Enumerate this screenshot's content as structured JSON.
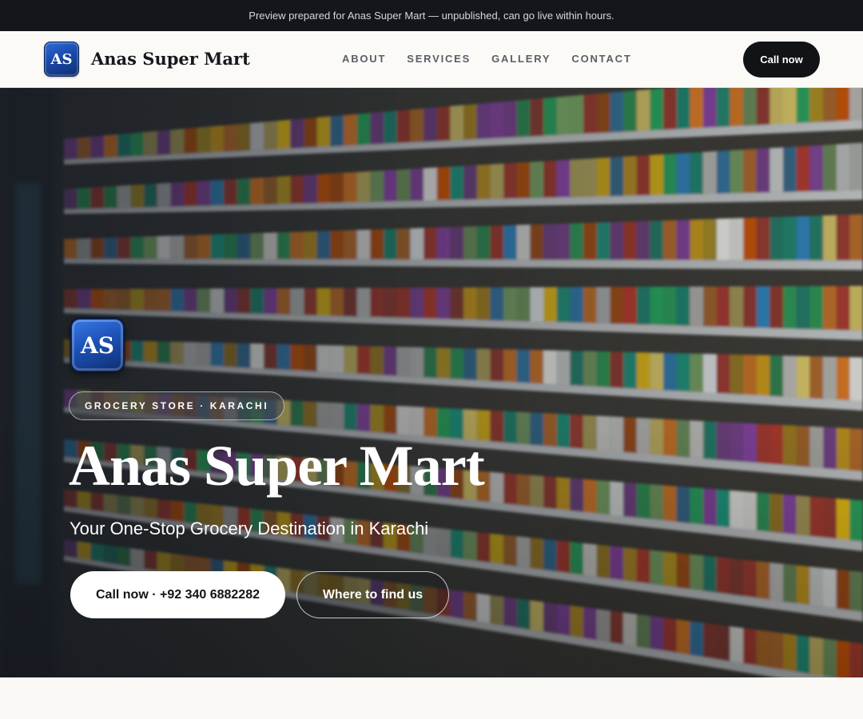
{
  "preview_banner": {
    "text": "Preview prepared for Anas Super Mart — unpublished, can go live within hours."
  },
  "header": {
    "logo_initials": "AS",
    "brand_name": "Anas Super Mart",
    "nav": [
      {
        "label": "ABOUT"
      },
      {
        "label": "SERVICES"
      },
      {
        "label": "GALLERY"
      },
      {
        "label": "CONTACT"
      }
    ],
    "cta_label": "Call now"
  },
  "hero": {
    "background_image": "supermarket-shelves-photo",
    "logo_initials": "AS",
    "eyebrow": "GROCERY STORE · KARACHI",
    "title": "Anas Super Mart",
    "subtitle": "Your One-Stop Grocery Destination in Karachi",
    "primary_button": "Call now · +92 340 6882282",
    "secondary_button": "Where to find us"
  },
  "colors": {
    "dark": "#111317",
    "preview_bar": "#14161b",
    "logo_blue": "#1d52b6",
    "page_bg": "#faf9f6"
  }
}
